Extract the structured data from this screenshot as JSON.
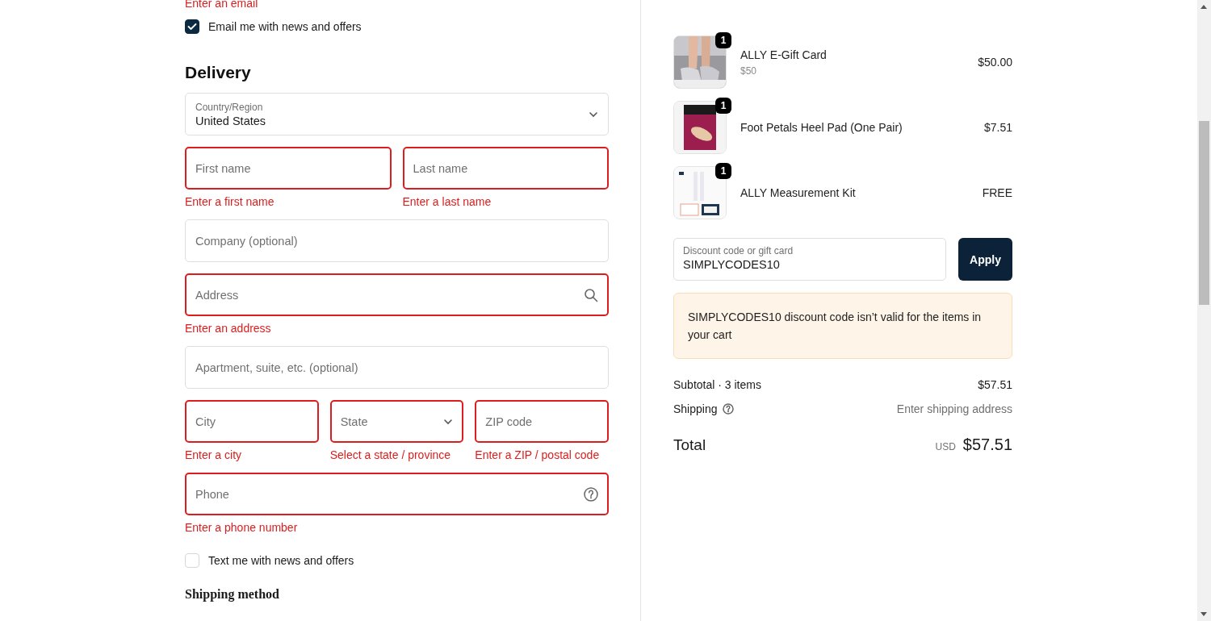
{
  "top_error": "Enter an email",
  "email_optin": {
    "label": "Email me with news and offers",
    "checked": true
  },
  "delivery": {
    "title": "Delivery",
    "rows": [
      [
        {
          "kind": "select",
          "label": "Country/Region",
          "value": "United States",
          "invalid": false
        }
      ],
      [
        {
          "kind": "text",
          "placeholder": "First name",
          "invalid": true,
          "error": "Enter a first name"
        },
        {
          "kind": "text",
          "placeholder": "Last name",
          "invalid": true,
          "error": "Enter a last name"
        }
      ],
      [
        {
          "kind": "text",
          "placeholder": "Company (optional)",
          "invalid": false
        }
      ],
      [
        {
          "kind": "search",
          "placeholder": "Address",
          "invalid": true,
          "error": "Enter an address"
        }
      ],
      [
        {
          "kind": "text",
          "placeholder": "Apartment, suite, etc. (optional)",
          "invalid": false
        }
      ],
      [
        {
          "kind": "text",
          "placeholder": "City",
          "invalid": true,
          "error": "Enter a city"
        },
        {
          "kind": "select",
          "placeholder": "State",
          "invalid": true,
          "error": "Select a state / province"
        },
        {
          "kind": "text",
          "placeholder": "ZIP code",
          "invalid": true,
          "error": "Enter a ZIP / postal code"
        }
      ],
      [
        {
          "kind": "help",
          "placeholder": "Phone",
          "invalid": true,
          "error": "Enter a phone number"
        }
      ]
    ]
  },
  "sms_optin": {
    "label": "Text me with news and offers",
    "checked": false
  },
  "shipping_method": {
    "title": "Shipping method"
  },
  "cart": {
    "items": [
      {
        "name": "ALLY E-Gift Card",
        "variant": "$50",
        "price": "$50.00",
        "quantity": "1",
        "kind": "picture"
      },
      {
        "name": "Foot Petals Heel Pad (One Pair)",
        "price": "$7.51",
        "quantity": "1",
        "kind": "picture"
      },
      {
        "name": "ALLY Measurement Kit",
        "price": "FREE",
        "quantity": "1",
        "kind": "picture"
      }
    ]
  },
  "discount": {
    "label": "Discount code or gift card",
    "value": "SIMPLYCODES10",
    "button": "Apply",
    "warning": "SIMPLYCODES10 discount code isn’t valid for the items in your cart"
  },
  "summary": {
    "subtotal_label": "Subtotal · 3 items",
    "subtotal": "$57.51",
    "shipping_label": "Shipping",
    "shipping": "Enter shipping address",
    "total_label": "Total",
    "currency": "USD",
    "total": "$57.51"
  }
}
